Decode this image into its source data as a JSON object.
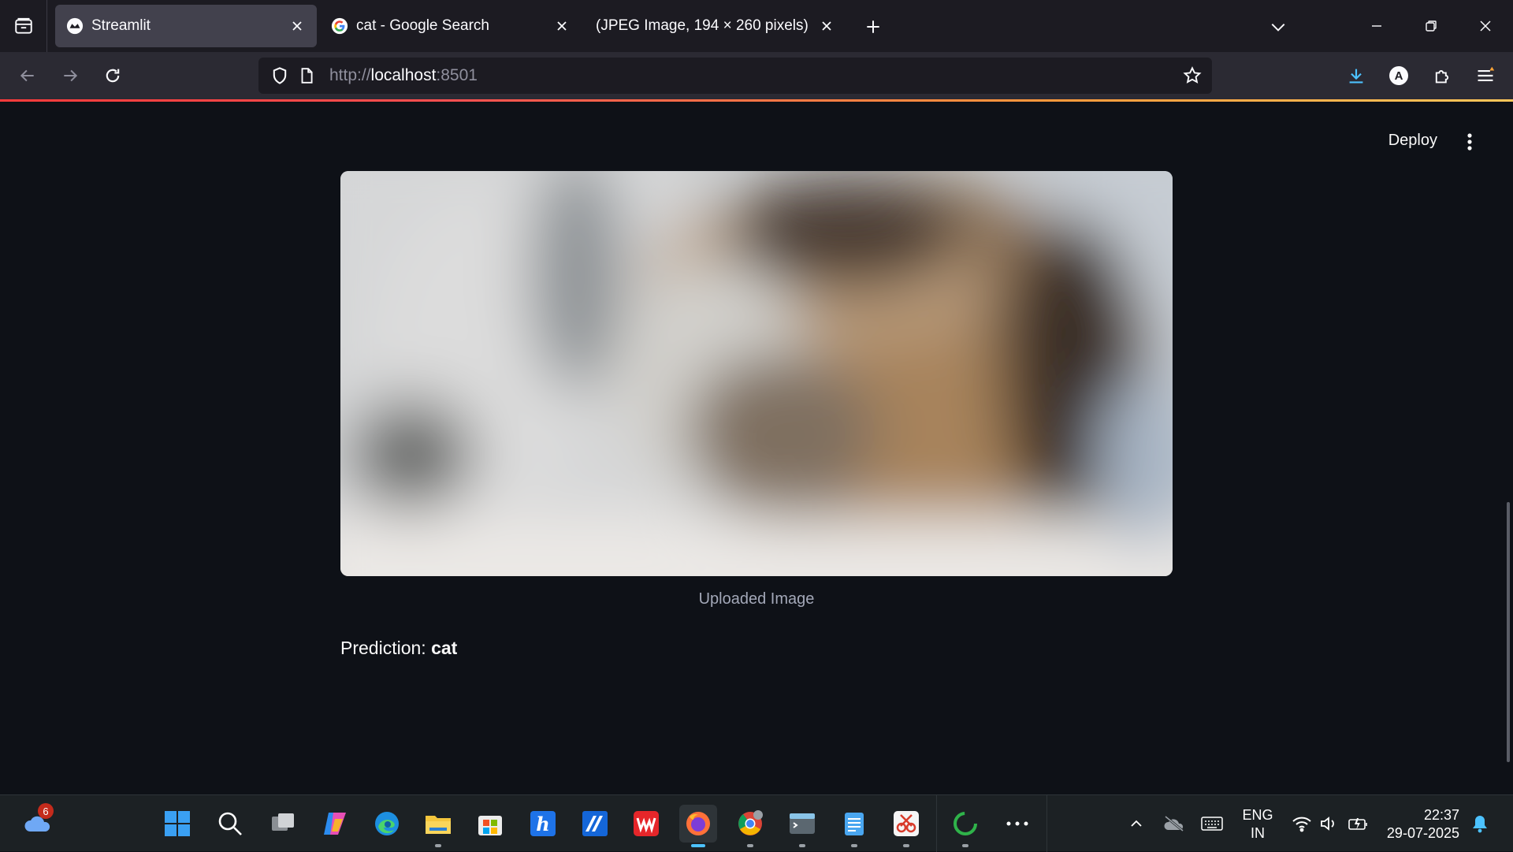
{
  "browser": {
    "tabs": [
      {
        "title": "Streamlit",
        "favicon": "streamlit-icon",
        "active": true
      },
      {
        "title": "cat - Google Search",
        "favicon": "google-icon",
        "active": false
      },
      {
        "title": "(JPEG Image, 194 × 260 pixels)",
        "favicon": "",
        "active": false
      }
    ],
    "url_scheme": "http://",
    "url_host": "localhost",
    "url_port": ":8501",
    "account_initial": "A"
  },
  "app": {
    "deploy_label": "Deploy",
    "image_caption": "Uploaded Image",
    "prediction_label": "Prediction:",
    "prediction_value": "cat"
  },
  "taskbar": {
    "weather_badge": "6",
    "apps": [
      "start-icon",
      "search-icon",
      "task-view-icon",
      "copilot-icon",
      "edge-icon",
      "file-explorer-icon",
      "microsoft-store-icon",
      "hp-icon",
      "app-icon",
      "wps-office-icon",
      "firefox-icon",
      "chrome-icon",
      "terminal-icon",
      "notepad-icon",
      "snipping-tool-icon",
      "loading-app-icon",
      "more-icon"
    ],
    "language": "ENG",
    "region": "IN",
    "time": "22:37",
    "date": "29-07-2025"
  },
  "colors": {
    "page_bg": "#0e1117",
    "tab_bar_bg": "#1c1b22",
    "nav_bar_bg": "#2b2a33",
    "active_tab_bg": "#42414d",
    "taskbar_bg": "#1c2124",
    "accent_blue": "#4cc2ff"
  }
}
